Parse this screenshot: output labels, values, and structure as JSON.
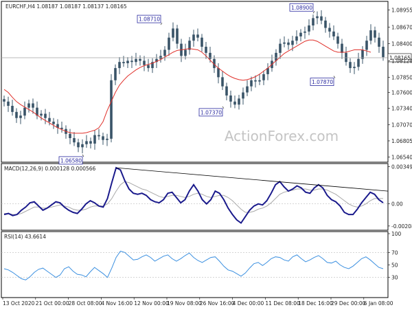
{
  "chart_data": [
    {
      "type": "line",
      "subtype": "candlestick",
      "title": "EURCHF,H4  1.08187 1.08187 1.08137 1.08165",
      "watermark": "ActionForex.com",
      "current_price_label": "1.08165",
      "ylim": [
        1.065,
        1.0905
      ],
      "y_ticks": [
        "1.08955",
        "1.08670",
        "1.08400",
        "1.08120",
        "1.07850",
        "1.07600",
        "1.07340",
        "1.07070",
        "1.06805",
        "1.06540"
      ],
      "x_ticks": [
        "13 Oct 2020",
        "21 Oct 00:00",
        "28 Oct 08:00",
        "4 Nov 16:00",
        "12 Nov 00:00",
        "19 Nov 08:00",
        "26 Nov 16:00",
        "4 Dec 00:00",
        "11 Dec 08:00",
        "18 Dec 16:00",
        "29 Dec 00:00",
        "6 Jan 08:00"
      ],
      "annotations": [
        "1.06580",
        "1.08710",
        "1.07370",
        "1.08900",
        "1.07870"
      ],
      "series": [
        {
          "values": [
            1.0745,
            1.0738,
            1.0728,
            1.0718,
            1.0722,
            1.0735,
            1.0742,
            1.0735,
            1.0722,
            1.0725,
            1.0718,
            1.0712,
            1.0708,
            1.0702,
            1.07,
            1.0692,
            1.0685,
            1.0678,
            1.067,
            1.0675,
            1.068,
            1.0676,
            1.069,
            1.0688,
            1.0682,
            1.0684,
            1.078,
            1.08,
            1.081,
            1.0808,
            1.0812,
            1.081,
            1.0815,
            1.0812,
            1.0805,
            1.08,
            1.081,
            1.0815,
            1.082,
            1.083,
            1.085,
            1.0865,
            1.084,
            1.082,
            1.083,
            1.0845,
            1.0855,
            1.085,
            1.0835,
            1.0825,
            1.0815,
            1.08,
            1.0785,
            1.077,
            1.0755,
            1.0745,
            1.074,
            1.075,
            1.076,
            1.077,
            1.078,
            1.0778,
            1.078,
            1.079,
            1.08,
            1.0812,
            1.0825,
            1.084,
            1.0842,
            1.0838,
            1.0845,
            1.0852,
            1.0858,
            1.086,
            1.087,
            1.0882,
            1.0885,
            1.0878,
            1.0866,
            1.086,
            1.0852,
            1.084,
            1.0825,
            1.081,
            1.08,
            1.0802,
            1.0815,
            1.083,
            1.0845,
            1.0862,
            1.085,
            1.0835,
            1.0818
          ]
        },
        {
          "values": [
            1.0765,
            1.076,
            1.0752,
            1.0745,
            1.074,
            1.0736,
            1.0732,
            1.0728,
            1.0723,
            1.0718,
            1.0714,
            1.071,
            1.0706,
            1.0702,
            1.0699,
            1.0696,
            1.0694,
            1.0693,
            1.0693,
            1.0693,
            1.0694,
            1.0696,
            1.0698,
            1.0702,
            1.0712,
            1.073,
            1.0745,
            1.076,
            1.0772,
            1.078,
            1.0787,
            1.0792,
            1.0797,
            1.0801,
            1.0804,
            1.0806,
            1.0808,
            1.0811,
            1.0814,
            1.0818,
            1.0822,
            1.0826,
            1.0829,
            1.083,
            1.0831,
            1.0832,
            1.0831,
            1.083,
            1.0826,
            1.082,
            1.0813,
            1.0806,
            1.08,
            1.0795,
            1.079,
            1.0786,
            1.0783,
            1.0781,
            1.078,
            1.0781,
            1.0783,
            1.0786,
            1.079,
            1.0795,
            1.08,
            1.0806,
            1.0812,
            1.0818,
            1.0824,
            1.0828,
            1.0832,
            1.0836,
            1.084,
            1.0844,
            1.0846,
            1.0846,
            1.0844,
            1.084,
            1.0836,
            1.0832,
            1.0828,
            1.0826,
            1.0826,
            1.0826,
            1.0828,
            1.083,
            1.083,
            1.083,
            1.0828,
            1.0826
          ]
        }
      ]
    },
    {
      "type": "line",
      "title": "MACD(12,26,9) 0.000128 0.000566",
      "ylim": [
        -0.00235,
        0.0036
      ],
      "y_ticks": [
        "0.00349",
        "0.00",
        "-0.002083"
      ],
      "series": [
        {
          "values": [
            -0.001,
            -0.0009,
            -0.0011,
            -0.001,
            -0.0006,
            -0.0003,
            0.0001,
            0.0002,
            -0.0002,
            -0.0006,
            -0.0004,
            -0.0001,
            0.0002,
            0.0001,
            -0.0003,
            -0.0006,
            -0.0008,
            -0.0009,
            -0.0005,
            0.0,
            0.0003,
            0.0001,
            -0.0002,
            -0.0003,
            0.0005,
            0.002,
            0.0034,
            0.0032,
            0.0022,
            0.0014,
            0.001,
            0.0009,
            0.001,
            0.0008,
            0.0004,
            0.0002,
            0.0001,
            0.0004,
            0.001,
            0.0011,
            0.0006,
            0.0001,
            0.0004,
            0.0012,
            0.0018,
            0.0012,
            0.0004,
            0.0,
            0.0004,
            0.0012,
            0.001,
            0.0004,
            -0.0004,
            -0.001,
            -0.0015,
            -0.0018,
            -0.0012,
            -0.0006,
            -0.0002,
            0.0,
            -0.0001,
            0.0003,
            0.001,
            0.0018,
            0.0021,
            0.0016,
            0.0012,
            0.0014,
            0.0017,
            0.0015,
            0.0011,
            0.001,
            0.0015,
            0.0018,
            0.0015,
            0.0008,
            0.0004,
            0.0002,
            -0.0002,
            -0.0008,
            -0.001,
            -0.001,
            -0.0005,
            0.0001,
            0.0006,
            0.0011,
            0.0009,
            0.0004,
            0.0001
          ]
        },
        {
          "values": [
            -0.0009,
            -0.0009,
            -0.001,
            -0.001,
            -0.0009,
            -0.0007,
            -0.0005,
            -0.0003,
            -0.0003,
            -0.0004,
            -0.0004,
            -0.0003,
            -0.0002,
            -0.0001,
            -0.0002,
            -0.0003,
            -0.0005,
            -0.0006,
            -0.0006,
            -0.0005,
            -0.0003,
            -0.0002,
            -0.0002,
            -0.0002,
            0.0,
            0.0005,
            0.0012,
            0.0018,
            0.0021,
            0.002,
            0.0018,
            0.0016,
            0.0014,
            0.0013,
            0.0011,
            0.0009,
            0.0007,
            0.0006,
            0.0007,
            0.0008,
            0.0008,
            0.0007,
            0.0006,
            0.0007,
            0.0009,
            0.001,
            0.0009,
            0.0007,
            0.0006,
            0.0007,
            0.0008,
            0.0008,
            0.0006,
            0.0003,
            -0.0001,
            -0.0005,
            -0.0008,
            -0.0008,
            -0.0007,
            -0.0005,
            -0.0004,
            -0.0002,
            0.0001,
            0.0005,
            0.0009,
            0.0011,
            0.0012,
            0.0013,
            0.0014,
            0.0014,
            0.0014,
            0.0013,
            0.0013,
            0.0014,
            0.0014,
            0.0013,
            0.0011,
            0.0009,
            0.0006,
            0.0003,
            0.0,
            -0.0002,
            -0.0003,
            -0.0002,
            0.0,
            0.0003,
            0.0005,
            0.0005,
            0.0005
          ]
        }
      ]
    },
    {
      "type": "line",
      "title": "RSI(14) 43.6614",
      "ylim": [
        0,
        100
      ],
      "y_ticks": [
        "100",
        "70",
        "50",
        "30"
      ],
      "series": [
        {
          "values": [
            44,
            42,
            38,
            33,
            28,
            26,
            31,
            38,
            43,
            45,
            40,
            35,
            30,
            34,
            44,
            47,
            40,
            35,
            34,
            31,
            39,
            46,
            41,
            36,
            30,
            45,
            62,
            72,
            70,
            64,
            58,
            59,
            63,
            66,
            62,
            56,
            60,
            64,
            66,
            60,
            56,
            60,
            65,
            69,
            62,
            57,
            54,
            58,
            62,
            63,
            56,
            48,
            42,
            40,
            36,
            32,
            37,
            45,
            52,
            54,
            49,
            54,
            60,
            63,
            62,
            58,
            56,
            63,
            66,
            60,
            55,
            58,
            62,
            65,
            60,
            54,
            53,
            56,
            50,
            46,
            44,
            48,
            54,
            60,
            63,
            58,
            52,
            46,
            44
          ]
        }
      ]
    }
  ]
}
